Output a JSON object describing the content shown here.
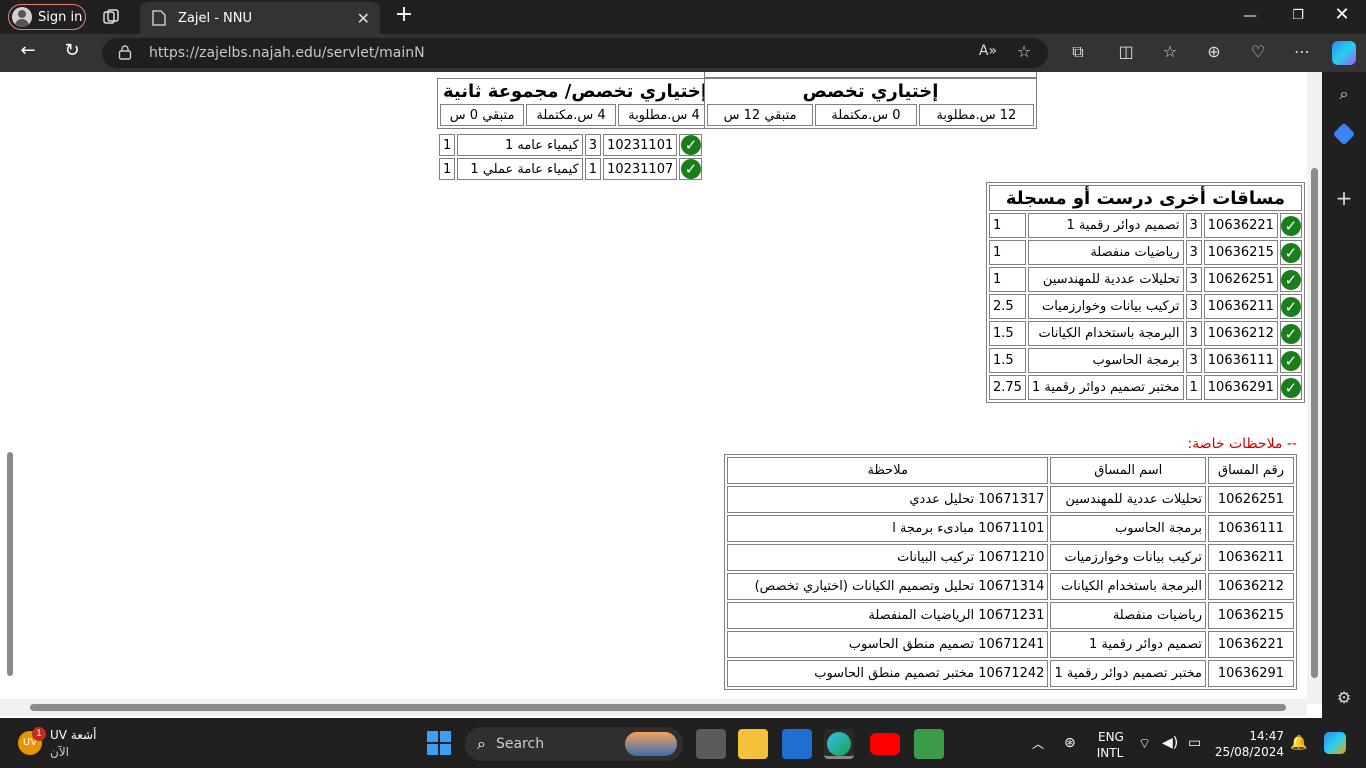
{
  "browser": {
    "signin_label": "Sign in",
    "tab_title": "Zajel - NNU",
    "url": "https://zajelbs.najah.edu/servlet/mainN"
  },
  "elective_group2": {
    "title": "إختياري تخصص/ مجموعة ثانية",
    "required": "4 س.مطلوبة",
    "completed": "4 س.مكتملة",
    "remaining": "متبقي 0 س",
    "rows": [
      {
        "code": "10231101",
        "hours": "3",
        "name": "كيمياء عامه 1",
        "grade": "1"
      },
      {
        "code": "10231107",
        "hours": "1",
        "name": "كيمياء عامة عملي 1",
        "grade": "1"
      }
    ]
  },
  "elective": {
    "title": "إختياري تخصص",
    "required": "12 س.مطلوبة",
    "completed": "0 س.مكتملة",
    "remaining": "متبقي 12 س"
  },
  "other_courses": {
    "title": "مساقات أخرى درست أو مسجلة",
    "rows": [
      {
        "code": "10636221",
        "hours": "3",
        "name": "تصميم دوائر رقمية 1",
        "grade": "1"
      },
      {
        "code": "10636215",
        "hours": "3",
        "name": "رياضيات منفصلة",
        "grade": "1"
      },
      {
        "code": "10626251",
        "hours": "3",
        "name": "تحليلات عددية للمهندسين",
        "grade": "1"
      },
      {
        "code": "10636211",
        "hours": "3",
        "name": "تركيب بيانات وخوارزميات",
        "grade": "2.5"
      },
      {
        "code": "10636212",
        "hours": "3",
        "name": "البرمجة باستخدام الكيانات",
        "grade": "1.5"
      },
      {
        "code": "10636111",
        "hours": "3",
        "name": "برمجة الحاسوب",
        "grade": "1.5"
      },
      {
        "code": "10636291",
        "hours": "1",
        "name": "مختبر تصميم دوائر رقمية 1",
        "grade": "2.75"
      }
    ]
  },
  "notes": {
    "title": "-- ملاحظات خاصة:",
    "col_code": "رقم المساق",
    "col_name": "اسم المساق",
    "col_note": "ملاحظة",
    "rows": [
      {
        "code": "10626251",
        "name": "تحليلات عددية للمهندسين",
        "note": "10671317 تحليل عددي"
      },
      {
        "code": "10636111",
        "name": "برمجة الحاسوب",
        "note": "10671101 مبادىء برمجة ا"
      },
      {
        "code": "10636211",
        "name": "تركيب بيانات وخوارزميات",
        "note": "10671210 تركيب البيانات"
      },
      {
        "code": "10636212",
        "name": "البرمجة باستخدام الكيانات",
        "note": "10671314 تحليل وتصميم الكيانات (اختياري تخصص)"
      },
      {
        "code": "10636215",
        "name": "رياضيات منفصلة",
        "note": "10671231 الرياضيات المنفصلة"
      },
      {
        "code": "10636221",
        "name": "تصميم دوائر رقمية 1",
        "note": "10671241 تصميم منطق الحاسوب"
      },
      {
        "code": "10636291",
        "name": "مختبر تصميم دوائر رقمية 1",
        "note": "10671242 مختبر تصميم منطق الحاسوب"
      }
    ]
  },
  "taskbar": {
    "weather_title": "أشعة UV",
    "weather_sub": "الآن",
    "weather_badge": "1",
    "search_label": "Search",
    "lang1": "ENG",
    "lang2": "INTL",
    "time": "14:47",
    "date": "25/08/2024"
  },
  "colors": {
    "notes_title": "#cc0000",
    "check": "#1a7f1a"
  }
}
